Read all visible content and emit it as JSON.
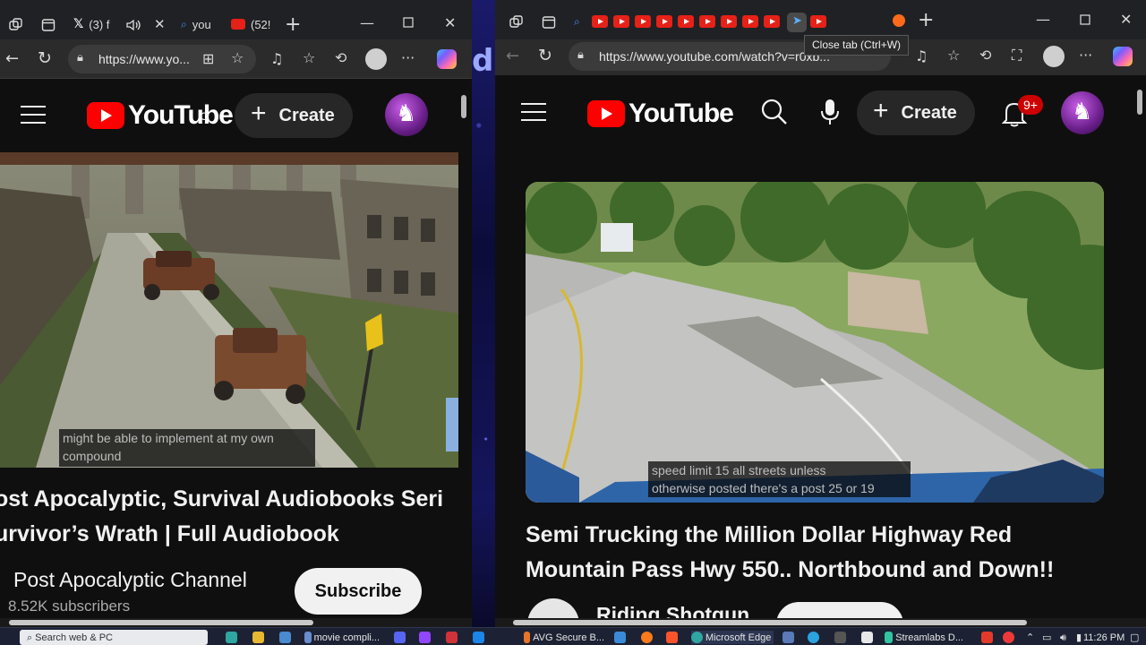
{
  "left_browser": {
    "tabs": [
      {
        "label": "(3) f",
        "icon": "x-logo-icon"
      },
      {
        "label": "you",
        "icon": "search-icon"
      },
      {
        "label": "(52!",
        "icon": "youtube-icon"
      }
    ],
    "url": "https://www.yo...",
    "youtube": {
      "logo_text": "YouTube",
      "create_label": "Create",
      "caption_lines": [
        "might be able to implement at my own",
        "compound"
      ],
      "title_lines": [
        "ost Apocalyptic, Survival Audiobooks Seri",
        "urvivor’s Wrath | Full Audiobook"
      ],
      "channel": "Post Apocalyptic Channel",
      "subscribers": "8.52K subscribers",
      "subscribe_label": "Subscribe"
    }
  },
  "right_browser": {
    "youtube_tab_count": 10,
    "tooltip": "Close tab (Ctrl+W)",
    "url": "https://www.youtube.com/watch?v=r0xb...",
    "youtube": {
      "logo_text": "YouTube",
      "create_label": "Create",
      "notification_badge": "9+",
      "caption_lines": [
        "speed limit 15 all streets unless",
        "otherwise posted there's a post 25 or 19"
      ],
      "title_lines": [
        "Semi Trucking the Million Dollar Highway Red",
        "Mountain Pass Hwy 550.. Northbound and Down!!"
      ],
      "channel": "Riding Shotgun"
    }
  },
  "background_letter": "d",
  "taskbar": {
    "search_placeholder": "Search web & PC",
    "items": [
      {
        "label": "movie compli...",
        "icon": "document-icon",
        "color": "#6a8cd0"
      },
      {
        "label": "AVG Secure B...",
        "icon": "avg-browser-icon",
        "color": "#e8742a"
      },
      {
        "label": "Microsoft Edge",
        "icon": "edge-icon",
        "color": "#2fa6a0"
      },
      {
        "label": "Streamlabs D...",
        "icon": "streamlabs-icon",
        "color": "#31c3a2"
      }
    ],
    "clock": "11:26 PM"
  },
  "colors": {
    "youtube_red": "#ff0000",
    "dark_bg": "#0f0f0f",
    "chrome_bg": "#202124"
  }
}
